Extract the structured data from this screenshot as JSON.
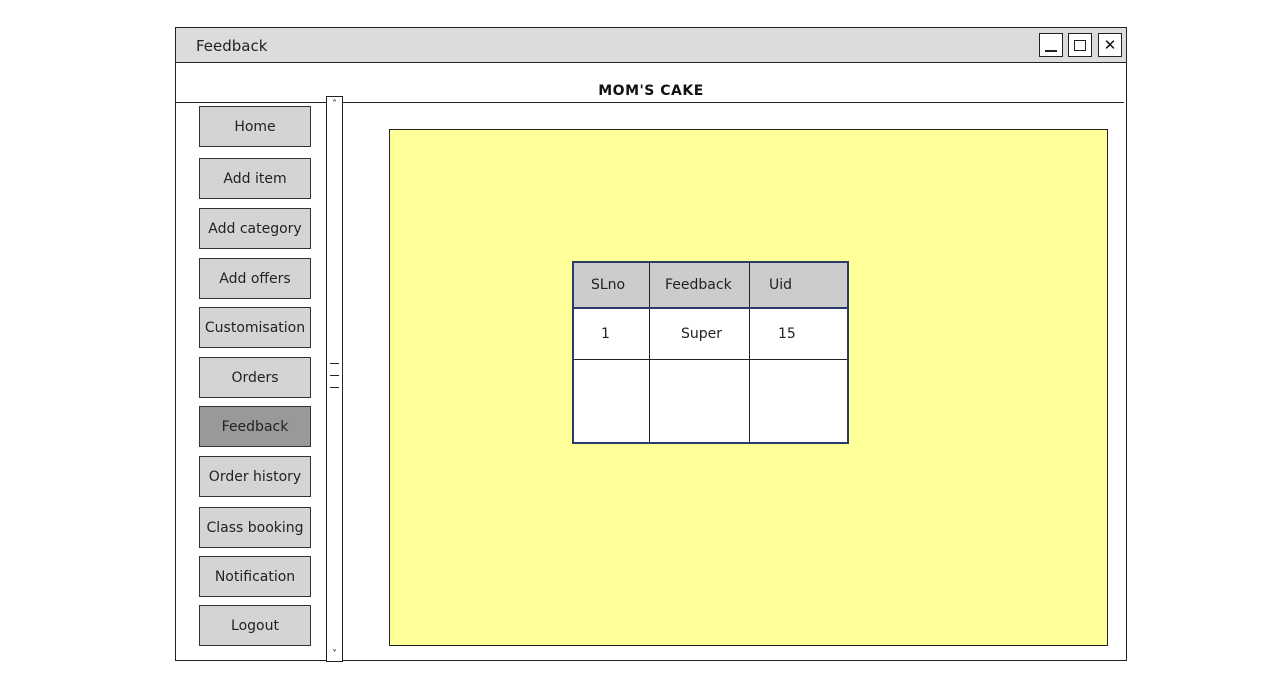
{
  "window": {
    "title": "Feedback",
    "controls": {
      "minimize_icon": "minimize-icon",
      "maximize_icon": "maximize-icon",
      "close_label": "✕"
    }
  },
  "header": {
    "brand": "MOM'S CAKE"
  },
  "sidebar": {
    "items": [
      {
        "label": "Home"
      },
      {
        "label": "Add item"
      },
      {
        "label": "Add category"
      },
      {
        "label": "Add offers"
      },
      {
        "label": "Customisation"
      },
      {
        "label": "Orders"
      },
      {
        "label": "Feedback",
        "active": true
      },
      {
        "label": "Order history"
      },
      {
        "label": "Class booking"
      },
      {
        "label": "Notification"
      },
      {
        "label": "Logout"
      }
    ]
  },
  "scrollbar": {
    "up_arrow": "˄",
    "down_arrow": "˅"
  },
  "feedback_table": {
    "columns": [
      "SLno",
      "Feedback",
      "Uid"
    ],
    "rows": [
      [
        "1",
        "Super",
        "15"
      ],
      [
        "",
        "",
        ""
      ]
    ]
  },
  "colors": {
    "content_background": "#ffff99",
    "nav_button": "#d4d4d4",
    "nav_button_active": "#999999",
    "table_border": "#2a3a6b",
    "table_header": "#cccccc",
    "titlebar": "#dcdcdc"
  }
}
